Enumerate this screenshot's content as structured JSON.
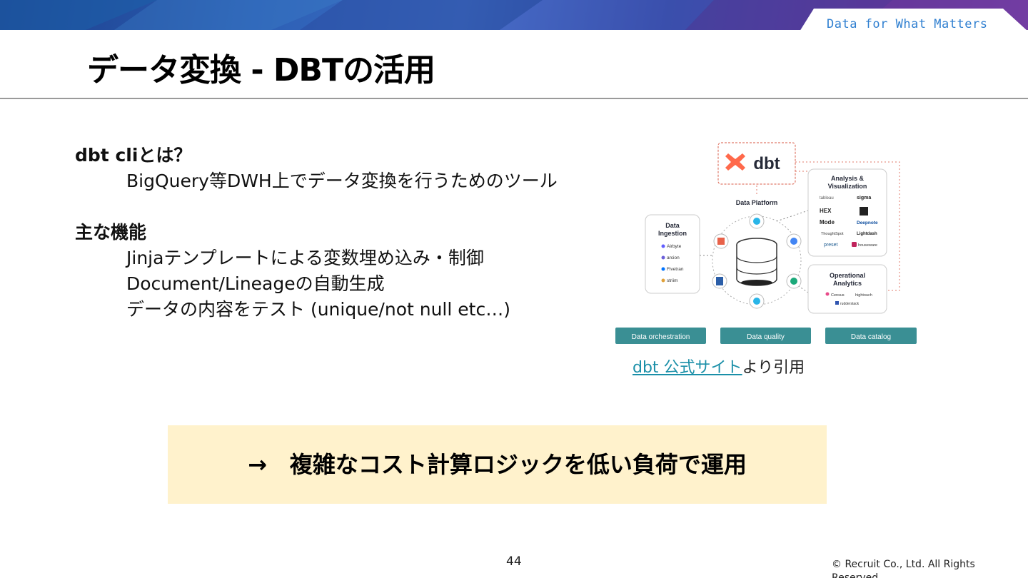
{
  "header": {
    "tagline": "Data for What Matters",
    "title": "データ変換 - DBTの活用"
  },
  "content": {
    "section1_heading": "dbt cliとは？",
    "section1_body": "BigQuery等DWH上でデータ変換を行うためのツール",
    "section2_heading": "主な機能",
    "features": [
      "Jinjaテンプレートによる変数埋め込み・制御",
      "Document/Lineageの自動生成",
      "データの内容をテスト (unique/not null etc…)"
    ]
  },
  "diagram": {
    "logo": "dbt",
    "platform_label": "Data Platform",
    "ingestion": {
      "title_line1": "Data",
      "title_line2": "Ingestion",
      "tools": [
        "Airbyte",
        "arcion",
        "Fivetran",
        "striim"
      ]
    },
    "analysis": {
      "title_line1": "Analysis &",
      "title_line2": "Visualization",
      "tools": [
        "tableau",
        "sigma",
        "HEX",
        "Mode",
        "Deepnote",
        "ThoughtSpot",
        "Lightdash",
        "preset",
        "houseware"
      ]
    },
    "operational": {
      "title_line1": "Operational",
      "title_line2": "Analytics",
      "tools": [
        "Census",
        "hightouch",
        "rudderstack"
      ]
    },
    "bottom_buttons": [
      "Data orchestration",
      "Data quality",
      "Data catalog"
    ]
  },
  "citation": {
    "link_text": "dbt 公式サイト",
    "suffix": "より引用"
  },
  "callout": {
    "text": "→　複雑なコスト計算ロジックを低い負荷で運用"
  },
  "footer": {
    "page_number": "44",
    "copyright": "© Recruit Co., Ltd. All Rights Reserved"
  },
  "colors": {
    "accent_teal": "#3a8f94",
    "dbt_orange": "#ff694b",
    "callout_bg": "#fff2cc",
    "link": "#1a8fa8"
  }
}
